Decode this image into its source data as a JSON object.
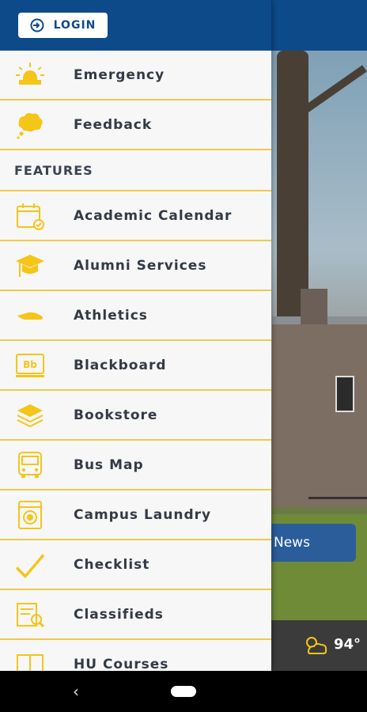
{
  "header": {
    "login_label": "LOGIN"
  },
  "top_items": [
    {
      "label": "Emergency",
      "icon": "siren-icon"
    },
    {
      "label": "Feedback",
      "icon": "thought-bubble-icon"
    }
  ],
  "section_title": "FEATURES",
  "features": [
    {
      "label": "Academic Calendar",
      "icon": "calendar-icon"
    },
    {
      "label": "Alumni Services",
      "icon": "graduation-cap-icon"
    },
    {
      "label": "Athletics",
      "icon": "sneaker-icon"
    },
    {
      "label": "Blackboard",
      "icon": "blackboard-icon"
    },
    {
      "label": "Bookstore",
      "icon": "books-icon"
    },
    {
      "label": "Bus Map",
      "icon": "bus-icon"
    },
    {
      "label": "Campus Laundry",
      "icon": "washing-machine-icon"
    },
    {
      "label": "Checklist",
      "icon": "checkmark-icon"
    },
    {
      "label": "Classifieds",
      "icon": "classifieds-icon"
    },
    {
      "label": "HU Courses",
      "icon": "courses-icon"
    }
  ],
  "background": {
    "news_label": "News",
    "temperature": "94°"
  },
  "colors": {
    "accent": "#f0c94a",
    "brand": "#0d4a8a",
    "icon_yellow": "#f5c518"
  }
}
